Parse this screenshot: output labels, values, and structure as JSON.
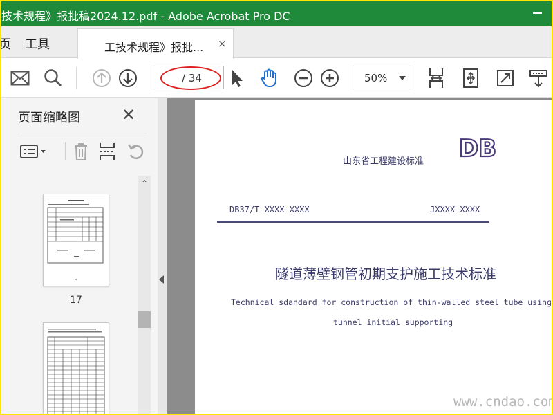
{
  "window": {
    "title": "技术规程》报批稿2024.12.pdf - Adobe Acrobat Pro DC"
  },
  "tabs": {
    "home": "页",
    "tools": "工具",
    "document": "工技术规程》报批...",
    "close_glyph": "×"
  },
  "toolbar": {
    "page_number": "",
    "page_total": "/ 34",
    "zoom": "50%"
  },
  "panel": {
    "title": "页面缩略图",
    "close_glyph": "✕",
    "thumbnails": [
      {
        "page": "17"
      }
    ]
  },
  "document": {
    "organization": "山东省工程建设标准",
    "logo": "DB",
    "code_left": "DB37/T XXXX-XXXX",
    "code_right": "JXXXX-XXXX",
    "title_cn": "隧道薄壁钢管初期支护施工技术标准",
    "title_en_line1": "Technical sdandard for construction of thin-walled steel tube using in",
    "title_en_line2": "tunnel initial supporting"
  },
  "watermark": "www.cndao.com",
  "colors": {
    "titlebar": "#1e8a3a",
    "annotation": "#e02020",
    "document_text": "#3a3a6a",
    "hand_tool": "#1f6fd1",
    "frame": "#ffe600"
  }
}
